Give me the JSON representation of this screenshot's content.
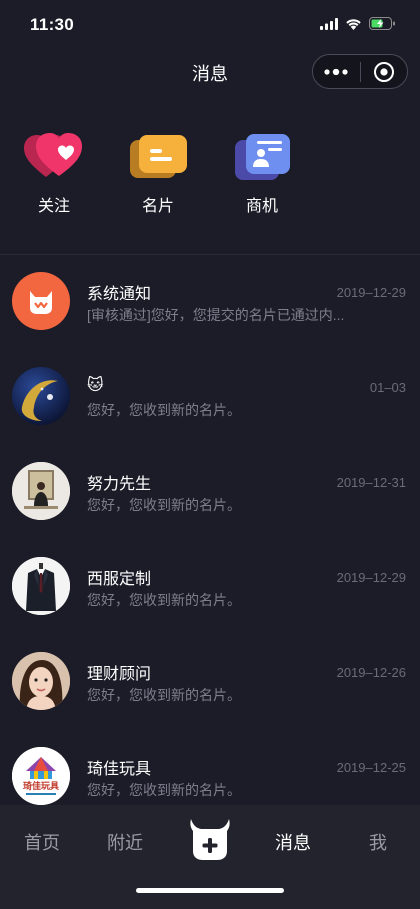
{
  "status_bar": {
    "time": "11:30",
    "icons": [
      "signal-icon",
      "wifi-icon",
      "battery-charging-icon"
    ]
  },
  "nav": {
    "title": "消息",
    "capsule_icons": [
      "more-dots-icon",
      "close-target-icon"
    ]
  },
  "shortcuts": [
    {
      "label": "关注",
      "icon": "heart-icon",
      "color": "#f0356a"
    },
    {
      "label": "名片",
      "icon": "card-icon",
      "color": "#f5b13c"
    },
    {
      "label": "商机",
      "icon": "business-card-icon",
      "color": "#6f8ff0"
    }
  ],
  "messages": [
    {
      "title": "系统通知",
      "preview": "[审核通过]您好，您提交的名片已通过内...",
      "date": "2019–12-29",
      "avatar": "system-notice-avatar"
    },
    {
      "title": "🐱",
      "preview": "您好，您收到新的名片。",
      "date": "01–03",
      "avatar": "moon-avatar"
    },
    {
      "title": "努力先生",
      "preview": "您好，您收到新的名片。",
      "date": "2019–12-31",
      "avatar": "person-avatar"
    },
    {
      "title": "西服定制",
      "preview": "您好，您收到新的名片。",
      "date": "2019–12-29",
      "avatar": "suit-avatar"
    },
    {
      "title": "理财顾问",
      "preview": "您好，您收到新的名片。",
      "date": "2019–12-26",
      "avatar": "woman-avatar"
    },
    {
      "title": "琦佳玩具",
      "preview": "您好，您收到新的名片。",
      "date": "2019–12-25",
      "avatar": "toy-logo-avatar",
      "logo_text": "琦佳玩具"
    }
  ],
  "tab_bar": {
    "tabs": [
      {
        "label": "首页",
        "active": false
      },
      {
        "label": "附近",
        "active": false
      },
      {
        "label": "消息",
        "active": true
      },
      {
        "label": "我",
        "active": false
      }
    ],
    "center_icon": "bull-add-icon"
  },
  "colors": {
    "background": "#1c1c28",
    "tab_bar_background": "#23232e",
    "system_avatar": "#f26640"
  }
}
